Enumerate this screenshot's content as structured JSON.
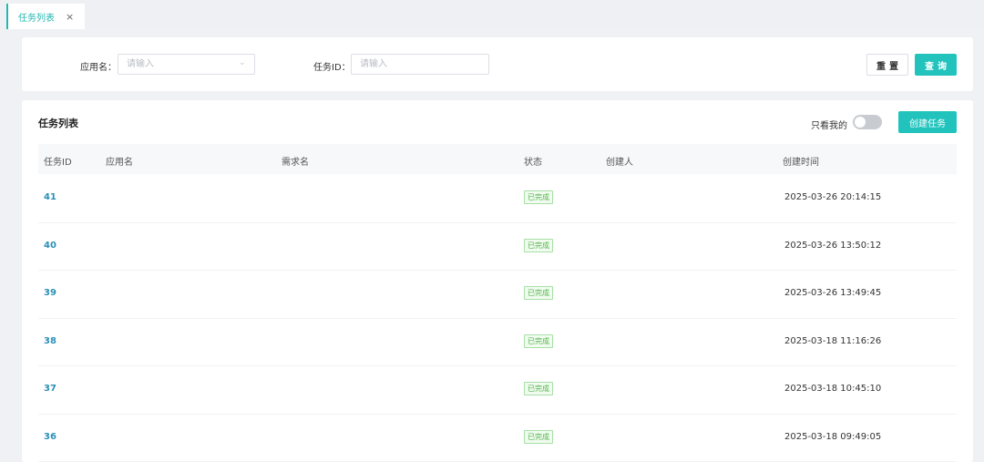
{
  "tab": {
    "label": "任务列表",
    "close": "×"
  },
  "filters": {
    "app_name_label": "应用名：",
    "app_name_placeholder": "请输入",
    "task_id_label": "任务ID：",
    "task_id_placeholder": "请输入",
    "reset_label": "重置",
    "query_label": "查询"
  },
  "list": {
    "title": "任务列表",
    "only_mine_label": "只看我的",
    "only_mine_on": false,
    "create_label": "创建任务",
    "columns": {
      "id": "任务ID",
      "app_name": "应用名",
      "requirement": "需求名",
      "status": "状态",
      "creator": "创建人",
      "created_at": "创建时间"
    },
    "rows": [
      {
        "id": "41",
        "status": "已完成",
        "created_at": "2025-03-26 20:14:15"
      },
      {
        "id": "40",
        "status": "已完成",
        "created_at": "2025-03-26 13:50:12"
      },
      {
        "id": "39",
        "status": "已完成",
        "created_at": "2025-03-26 13:49:45"
      },
      {
        "id": "38",
        "status": "已完成",
        "created_at": "2025-03-18 11:16:26"
      },
      {
        "id": "37",
        "status": "已完成",
        "created_at": "2025-03-18 10:45:10"
      },
      {
        "id": "36",
        "status": "已完成",
        "created_at": "2025-03-18 09:49:05"
      }
    ]
  },
  "colors": {
    "accent": "#22c3bd",
    "link": "#2a8fb8",
    "success": "#52b44a"
  }
}
